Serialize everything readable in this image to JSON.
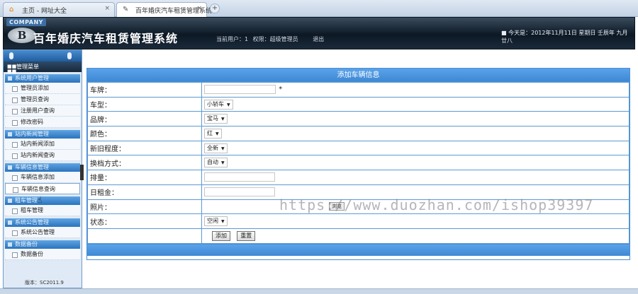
{
  "browser": {
    "tabs": [
      {
        "label": "主页 - 网址大全",
        "close": "×"
      },
      {
        "label": "百年婚庆汽车租赁管理系统",
        "close": "×"
      }
    ],
    "newtab": "+"
  },
  "header": {
    "company": "COMPANY",
    "logo_letter": "B",
    "title": "百年婚庆汽车租赁管理系统",
    "user_label": "当前用户：1",
    "role_label": "权限：超级管理员",
    "logout": "退出",
    "today": "■ 今天是：2012年11月11日 星期日 壬辰年 九月廿八"
  },
  "sidebar": {
    "menu_title": "管理菜单",
    "groups": [
      {
        "title": "系统用户管理",
        "items": [
          "管理员添加",
          "管理员查询",
          "注册用户查询",
          "修改密码"
        ]
      },
      {
        "title": "站内新闻管理",
        "items": [
          "站内新闻添加",
          "站内新闻查询"
        ]
      },
      {
        "title": "车辆信息管理",
        "items": [
          "车辆信息添加",
          "车辆信息查询"
        ]
      },
      {
        "title": "租车管理",
        "items": [
          "租车管理"
        ]
      },
      {
        "title": "系统公告管理",
        "items": [
          "系统公告管理"
        ]
      },
      {
        "title": "数据备份",
        "items": [
          "数据备份"
        ]
      }
    ],
    "version": "版本：SC2011.9"
  },
  "form": {
    "title": "添加车辆信息",
    "rows": {
      "plate": {
        "label": "车牌：",
        "required": "*"
      },
      "type": {
        "label": "车型：",
        "selected": "小轿车"
      },
      "brand": {
        "label": "品牌：",
        "selected": "宝马"
      },
      "color": {
        "label": "颜色：",
        "selected": "红"
      },
      "condition": {
        "label": "新旧程度：",
        "selected": "全新"
      },
      "gear": {
        "label": "换档方式：",
        "selected": "自动"
      },
      "displacement": {
        "label": "排量："
      },
      "rent": {
        "label": "日租金："
      },
      "photo": {
        "label": "照片：",
        "browse": "浏览"
      },
      "status": {
        "label": "状态：",
        "selected": "空闲"
      }
    },
    "buttons": {
      "add": "添加",
      "reset": "重置"
    }
  },
  "watermark": "https://www.duozhan.com/ishop39397"
}
